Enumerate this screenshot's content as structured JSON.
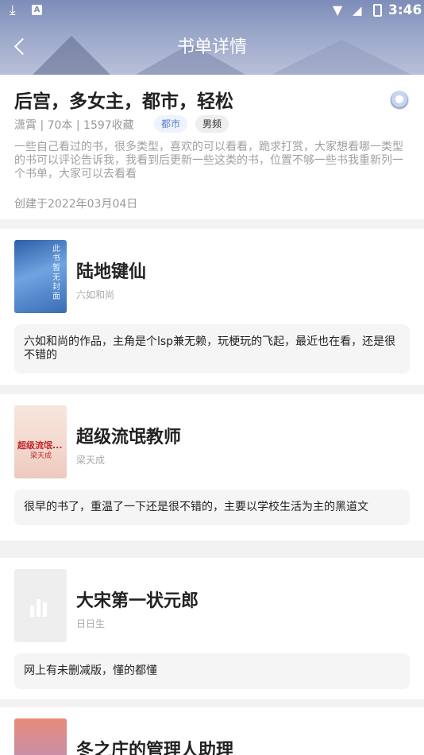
{
  "status_bar": {
    "time": "3:46",
    "icons": [
      "download-icon",
      "a-icon",
      "wifi-icon",
      "signal-icon",
      "battery-icon"
    ]
  },
  "nav": {
    "title": "书单详情",
    "back_icon": "back-arrow-icon"
  },
  "booklist": {
    "title": "后宫，多女主，都市，轻松",
    "meta": "潇霄 | 70本 | 1597收藏",
    "tags": [
      "都市",
      "男频"
    ],
    "description": "一些自己看过的书，很多类型，喜欢的可以看看，跪求打赏，大家想看哪一类型的书可以评论告诉我，我看到后更新一些这类的书，位置不够一些书我重新列一个书单，大家可以去看看",
    "created": "创建于2022年03月04日"
  },
  "books": [
    {
      "title": "陆地键仙",
      "author": "六如和尚",
      "cover_text": "此书暂无封面",
      "note": "六如和尚的作品，主角是个lsp兼无赖，玩梗玩的飞起，最近也在看，还是很不错的"
    },
    {
      "title": "超级流氓教师",
      "author": "梁天成",
      "cover_text": "超级流氓...",
      "cover_author": "梁天成",
      "note": "很早的书了，重温了一下还是很不错的，主要以学校生活为主的黑道文"
    },
    {
      "title": "大宋第一状元郎",
      "author": "日日生",
      "note": "网上有未删减版，懂的都懂"
    },
    {
      "title": "冬之庄的管理人助理"
    }
  ]
}
